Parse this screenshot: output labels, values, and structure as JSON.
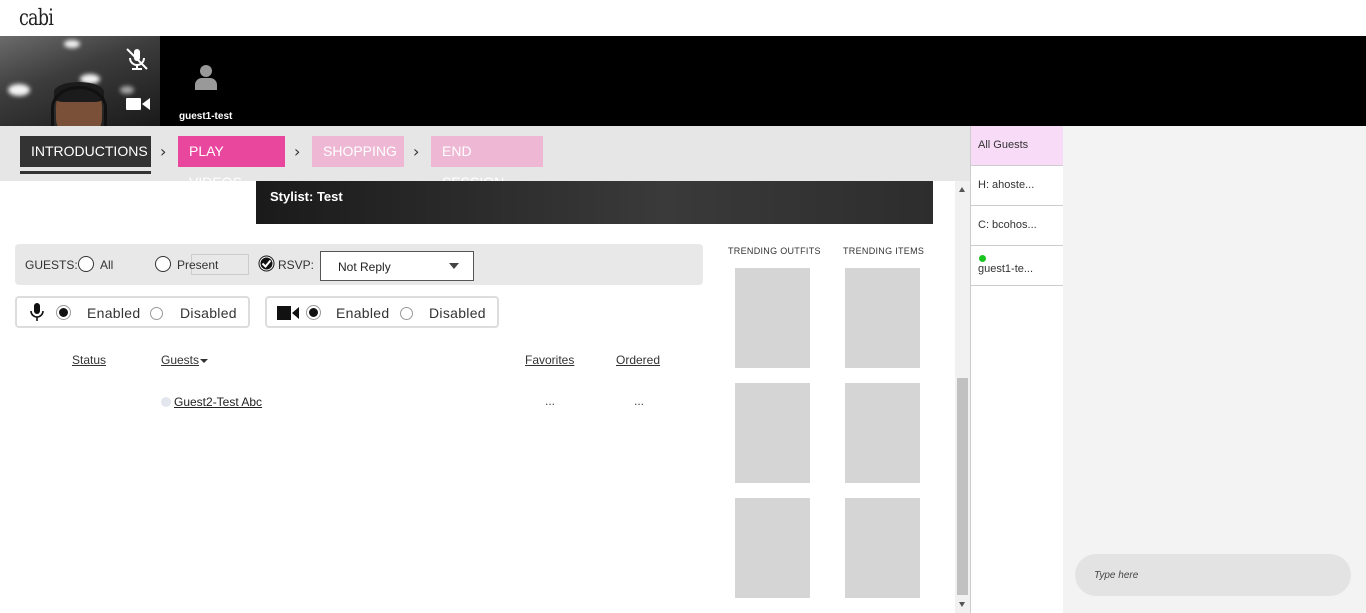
{
  "brand": {
    "logo_text": "cabi"
  },
  "video": {
    "self_icons": [
      "mic-off-icon",
      "video-camera-icon"
    ],
    "guest": {
      "name": "guest1-test",
      "icon": "user-avatar-icon"
    }
  },
  "steps": [
    {
      "label": "INTRODUCTIONS",
      "state": "current"
    },
    {
      "label": "PLAY VIDEOS",
      "state": "next"
    },
    {
      "label": "SHOPPING",
      "state": "disabled"
    },
    {
      "label": "END SESSION",
      "state": "disabled"
    }
  ],
  "stylist": {
    "label": "Stylist: Test"
  },
  "filters": {
    "guests_label": "GUESTS:",
    "all_label": "All",
    "present_label": "Present",
    "rsvp_label": "RSVP:",
    "rsvp_value": "Not Reply"
  },
  "audio": {
    "enabled_label": "Enabled",
    "disabled_label": "Disabled",
    "selected": "Enabled"
  },
  "videoctl": {
    "enabled_label": "Enabled",
    "disabled_label": "Disabled",
    "selected": "Enabled"
  },
  "table": {
    "headers": {
      "status": "Status",
      "guests": "Guests",
      "favorites": "Favorites",
      "ordered": "Ordered"
    },
    "rows": [
      {
        "name": "Guest2-Test Abc",
        "favorites": "...",
        "ordered": "..."
      }
    ]
  },
  "trending": {
    "outfits_title": "TRENDING OUTFITS",
    "items_title": "TRENDING ITEMS"
  },
  "chat": {
    "tabs": [
      {
        "label": "All Guests",
        "active": true
      },
      {
        "label": "H: ahoste..."
      },
      {
        "label": "C: bcohos..."
      },
      {
        "label": "guest1-te...",
        "online": true
      }
    ],
    "input_placeholder": "Type here"
  },
  "colors": {
    "accent_pink": "#e8479d",
    "disabled_pink": "#eeb8d4",
    "dark": "#333333",
    "active_tab": "#f8dbf7",
    "online": "#19c41f"
  }
}
